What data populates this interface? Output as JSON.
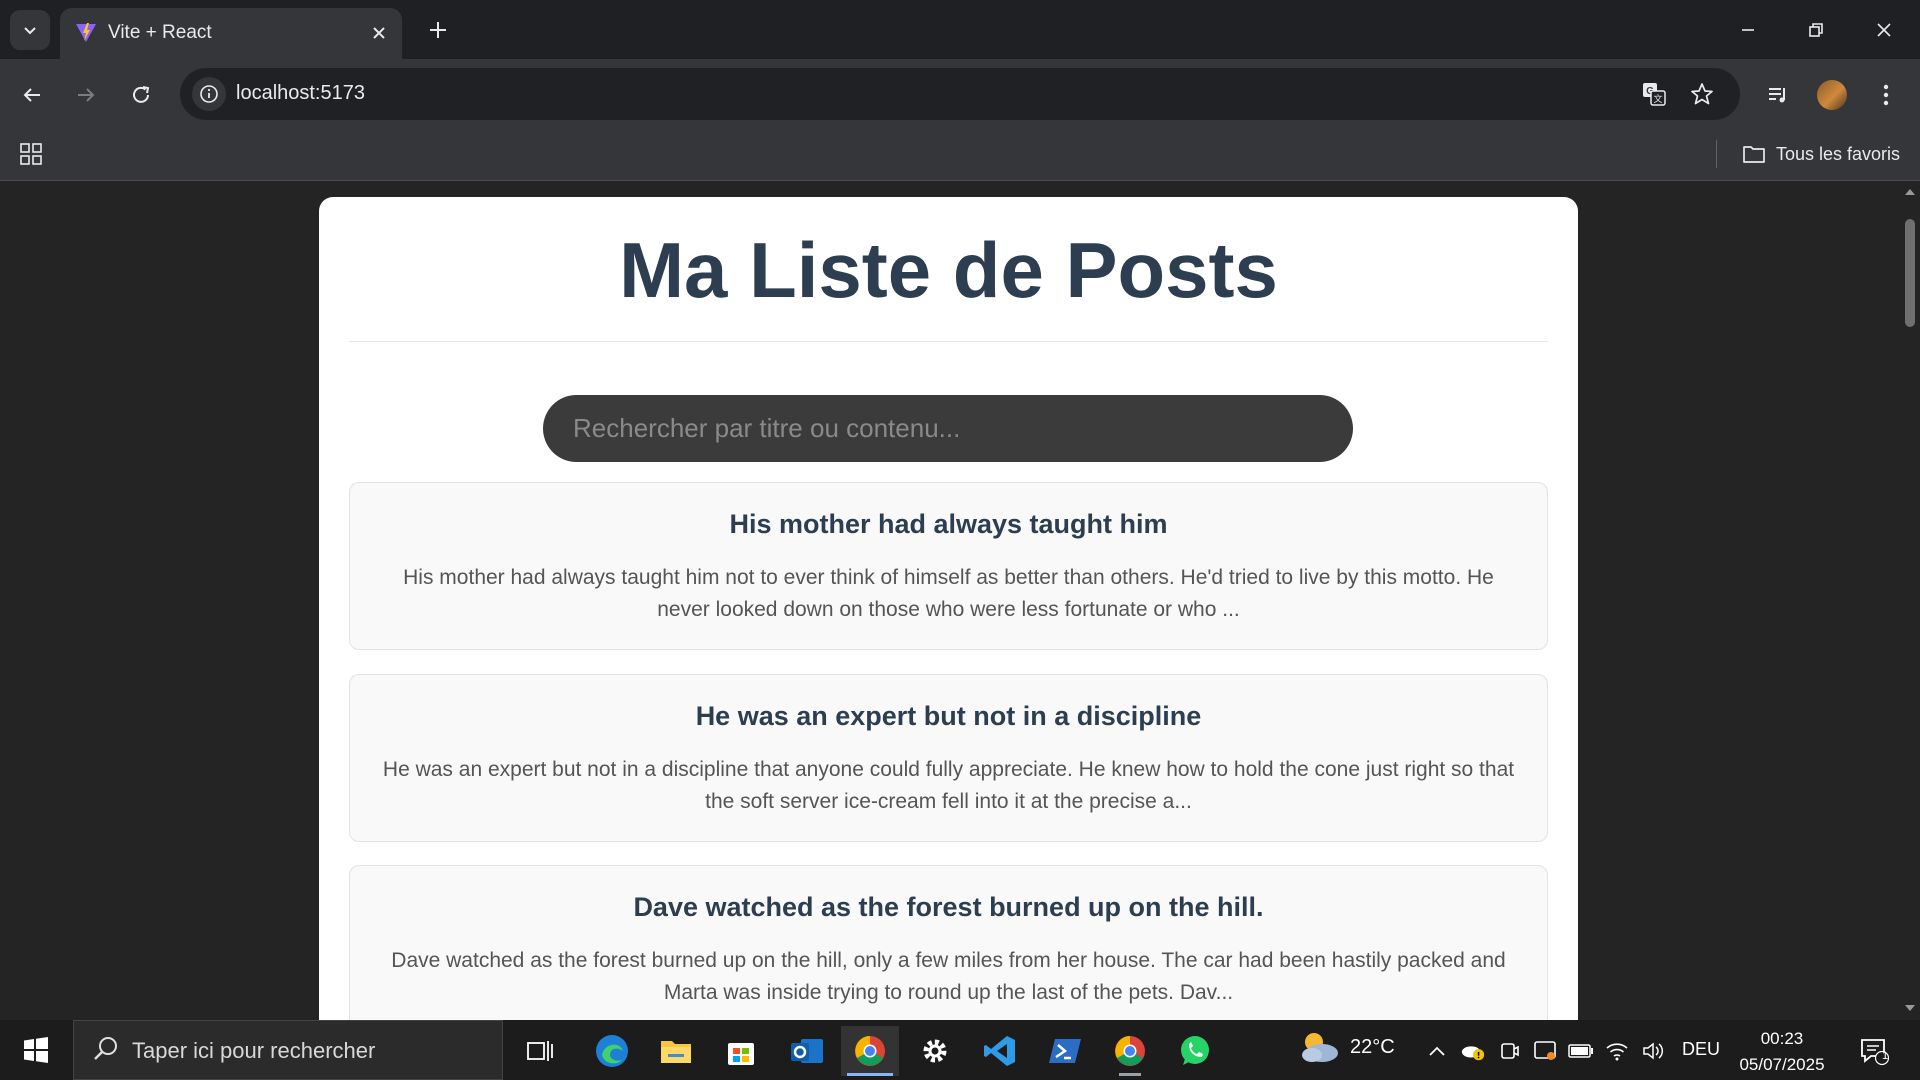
{
  "browser": {
    "tab_title": "Vite + React",
    "url": "localhost:5173",
    "bookmarks_folder": "Tous les favoris"
  },
  "page": {
    "title": "Ma Liste de Posts",
    "search_placeholder": "Rechercher par titre ou contenu...",
    "posts": [
      {
        "title": "His mother had always taught him",
        "excerpt": "His mother had always taught him not to ever think of himself as better than others. He'd tried to live by this motto. He never looked down on those who were less fortunate or who ..."
      },
      {
        "title": "He was an expert but not in a discipline",
        "excerpt": "He was an expert but not in a discipline that anyone could fully appreciate. He knew how to hold the cone just right so that the soft server ice-cream fell into it at the precise a..."
      },
      {
        "title": "Dave watched as the forest burned up on the hill.",
        "excerpt": "Dave watched as the forest burned up on the hill, only a few miles from her house. The car had been hastily packed and Marta was inside trying to round up the last of the pets. Dav..."
      }
    ]
  },
  "taskbar": {
    "search_placeholder": "Taper ici pour rechercher",
    "weather_temp": "22°C",
    "language": "DEU",
    "time": "00:23",
    "date": "05/07/2025",
    "notification_count": "1"
  },
  "colors": {
    "title": "#2c3e50",
    "search_bg": "#3b3b3b",
    "page_bg": "#242424",
    "card_bg": "#ffffff"
  }
}
